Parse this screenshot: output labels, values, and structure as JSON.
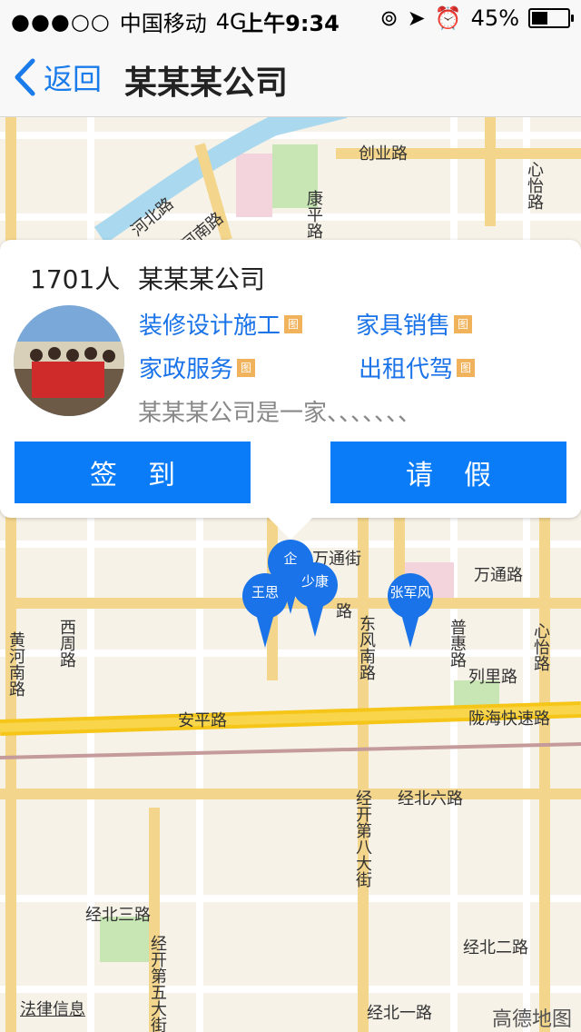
{
  "status_bar": {
    "signal": "●●●○○",
    "carrier": "中国移动",
    "network": "4G",
    "time": "上午9:34",
    "battery_text": "45%",
    "battery_level": 0.45
  },
  "nav": {
    "back_label": "返回",
    "title": "某某某公司"
  },
  "popup": {
    "count": "1701人",
    "company_name": "某某某公司",
    "tags": [
      {
        "label": "装修设计施工"
      },
      {
        "label": "家具销售"
      },
      {
        "label": "家政服务"
      },
      {
        "label": "出租代驾"
      }
    ],
    "tag_icon_text": "图",
    "description": "某某某公司是一家、、、、、、、",
    "checkin_label": "签到",
    "leave_label": "请假"
  },
  "map": {
    "road_labels": {
      "chuangye": "创业路",
      "xinyi_top": "心怡路",
      "he_bei": "河北路",
      "he_nan": "河南路",
      "kang_ping": "康平路",
      "wantong_jie": "万通街",
      "wantong_lu": "万通路",
      "lu": "路",
      "dongfeng": "东风南路",
      "puhui": "普惠路",
      "xinyi_bottom": "心怡路",
      "huanghe": "黄河南路",
      "xizhou": "西周路",
      "lieli": "列里路",
      "anping": "安平路",
      "longhai": "陇海快速路",
      "jingbei6": "经北六路",
      "jingkai8": "经开第八大街",
      "jingbei3": "经北三路",
      "jingbei2": "经北二路",
      "jingkai5": "经开第五大街",
      "jingbei1": "经北一路"
    },
    "markers": [
      {
        "label": "企"
      },
      {
        "label": "王思"
      },
      {
        "label": "少康"
      },
      {
        "label": "张军风"
      }
    ]
  },
  "footer": {
    "legal": "法律信息",
    "brand": "高德地图"
  },
  "colors": {
    "accent": "#0a7cf8",
    "marker": "#1a73e8",
    "highway": "#f5c518",
    "river": "#a9d8ef",
    "green": "#c7e6b4"
  }
}
